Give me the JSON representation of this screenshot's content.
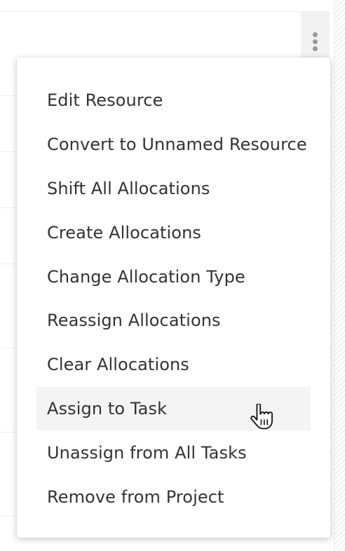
{
  "menu": {
    "items": [
      {
        "label": "Edit Resource"
      },
      {
        "label": "Convert to Unnamed Resource"
      },
      {
        "label": "Shift All Allocations"
      },
      {
        "label": "Create Allocations"
      },
      {
        "label": "Change Allocation Type"
      },
      {
        "label": "Reassign Allocations"
      },
      {
        "label": "Clear Allocations"
      },
      {
        "label": "Assign to Task"
      },
      {
        "label": "Unassign from All Tasks"
      },
      {
        "label": "Remove from Project"
      }
    ],
    "hovered_item": "Assign to Task"
  },
  "icons": {
    "more_button": "more-vertical-icon",
    "cursor": "hand-pointer-cursor-icon"
  },
  "colors": {
    "menu_text": "#333333",
    "hover_background": "#f4f4f4",
    "kebab_background": "#f2f2f2"
  }
}
